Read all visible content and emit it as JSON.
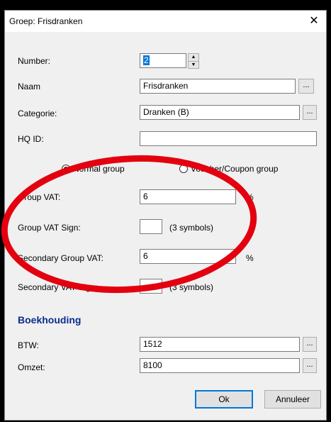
{
  "window": {
    "title": "Groep: Frisdranken",
    "close_glyph": "✕"
  },
  "form": {
    "number_label": "Number:",
    "number_value": "2",
    "naam_label": "Naam",
    "naam_value": "Frisdranken",
    "categorie_label": "Categorie:",
    "categorie_value": "Dranken (B)",
    "hqid_label": "HQ ID:",
    "hqid_value": "",
    "browse_label": "...",
    "radio_normal": "Normal group",
    "radio_voucher": "Voucher/Coupon group",
    "group_vat_label": "Group VAT:",
    "group_vat_value": "6",
    "group_vat_unit": "%",
    "group_vat_sign_label": "Group VAT Sign:",
    "group_vat_sign_value": "",
    "group_vat_sign_hint": "(3 symbols)",
    "secondary_vat_label": "Secondary Group VAT:",
    "secondary_vat_value": "6",
    "secondary_vat_unit": "%",
    "secondary_vat_sign_label": "Secondary VAT Sign:",
    "secondary_vat_sign_value": "",
    "secondary_vat_sign_hint": "(3 symbols)"
  },
  "boekhouding": {
    "heading": "Boekhouding",
    "btw_label": "BTW:",
    "btw_value": "1512",
    "omzet_label": "Omzet:",
    "omzet_value": "8100"
  },
  "buttons": {
    "ok": "Ok",
    "cancel": "Annuleer"
  },
  "colors": {
    "annotation": "#e3000f",
    "section_heading": "#0a2d8e",
    "selection": "#0078d7"
  }
}
